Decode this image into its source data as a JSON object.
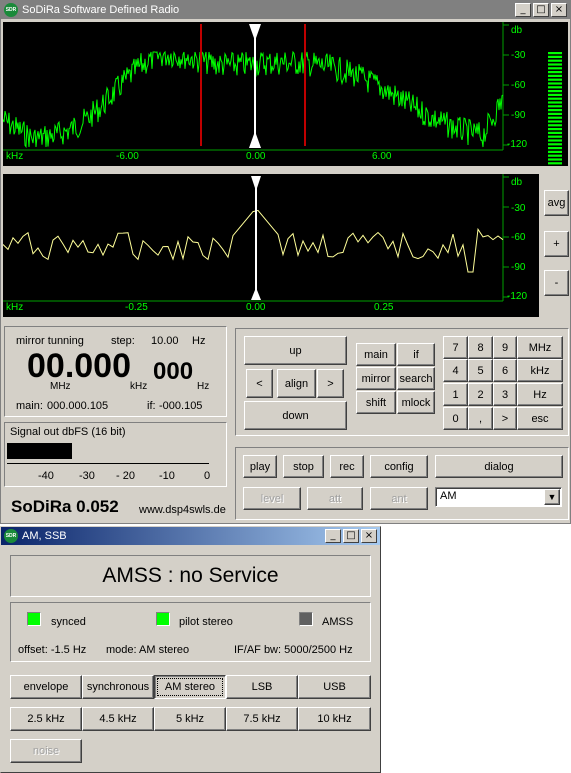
{
  "main_window": {
    "title": "SoDiRa Software Defined Radio",
    "logo_text": "SoDiRa"
  },
  "spectrum_top": {
    "db_label": "db",
    "y_ticks": [
      "-30",
      "-60",
      "-90",
      "-120"
    ],
    "khz_label": "kHz",
    "x_ticks": [
      "-6.00",
      "0.00",
      "6.00"
    ],
    "trace_color": "#00ff00",
    "marker_color": "#c00000"
  },
  "spectrum_bottom": {
    "db_label": "db",
    "y_ticks": [
      "-30",
      "-60",
      "-90",
      "-120"
    ],
    "khz_label": "kHz",
    "x_ticks": [
      "-0.25",
      "0.00",
      "0.25"
    ],
    "trace_color": "#ffff99"
  },
  "side_buttons": {
    "avg": "avg",
    "plus": "+",
    "minus": "-"
  },
  "tuning": {
    "mode_label": "mirror tunning",
    "step_label": "step:",
    "step_value": "10.00",
    "step_unit": "Hz",
    "freq_big": "00.000",
    "freq_small": "000",
    "unit_mhz": "MHz",
    "unit_khz": "kHz",
    "unit_hz": "Hz",
    "main_label": "main:",
    "main_value": "000.000.105",
    "if_label": "if:",
    "if_value": "-000.105"
  },
  "signal": {
    "title": "Signal out dbFS (16 bit)",
    "scale": [
      "-40",
      "-30",
      "- 20",
      "-10",
      "0"
    ],
    "level_fraction": 0.3
  },
  "brand": {
    "name": "SoDiRa 0.052",
    "url": "www.dsp4swls.de"
  },
  "nav": {
    "up": "up",
    "left": "<",
    "align": "align",
    "right": ">",
    "down": "down"
  },
  "modes": [
    "main",
    "if",
    "mirror",
    "search",
    "shift",
    "mlock"
  ],
  "keypad": [
    "7",
    "8",
    "9",
    "MHz",
    "4",
    "5",
    "6",
    "kHz",
    "1",
    "2",
    "3",
    "Hz",
    "0",
    ",",
    ">",
    "esc"
  ],
  "transport": {
    "play": "play",
    "stop": "stop",
    "rec": "rec",
    "config": "config",
    "dialog": "dialog"
  },
  "disabled": {
    "level": "level",
    "att": "att",
    "ant": "ant"
  },
  "demod_select": {
    "value": "AM"
  },
  "am_window": {
    "title": "AM, SSB",
    "status": "AMSS : no Service",
    "synced": "synced",
    "pilot": "pilot stereo",
    "amss": "AMSS",
    "offset": "offset: -1.5 Hz",
    "mode": "mode: AM stereo",
    "bw": "IF/AF bw: 5000/2500 Hz",
    "led_on_color": "#00ff00",
    "led_off_color": "#606060",
    "demods": [
      "envelope",
      "synchronous",
      "AM stereo",
      "LSB",
      "USB"
    ],
    "bandwidths": [
      "2.5 kHz",
      "4.5 kHz",
      "5 kHz",
      "7.5 kHz",
      "10 kHz"
    ],
    "noise": "noise"
  }
}
